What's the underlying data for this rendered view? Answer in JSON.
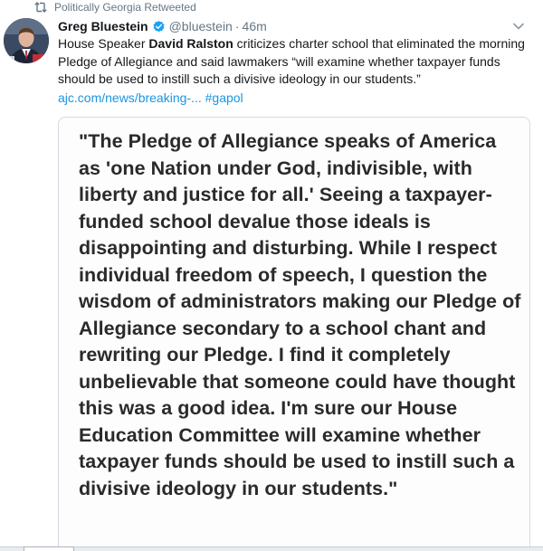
{
  "retweet": {
    "label": "Politically Georgia Retweeted",
    "icon": "retweet-icon"
  },
  "author": {
    "name": "Greg Bluestein",
    "handle": "@bluestein",
    "separator": "·",
    "time": "46m",
    "verified": true
  },
  "tweet": {
    "text_pre": "House Speaker ",
    "text_bold": "David Ralston",
    "text_post": " criticizes charter school that eliminated the morning Pledge of Allegiance and said lawmakers “will examine whether taxpayer funds should be used to instill such a divisive ideology in our students.”",
    "link": "ajc.com/news/breaking-...",
    "hashtag": "#gapol"
  },
  "image": {
    "quote": "\"The Pledge of Allegiance speaks of America as 'one Nation under God, indivisible, with liberty and justice for all.' Seeing a taxpayer-funded school devalue those ideals is disappointing and disturbing. While I respect individual freedom of speech, I question the wisdom of administrators making our Pledge of Allegiance secondary to a school chant and rewriting our Pledge. I find it completely unbelievable that someone could have thought this was a good idea. I'm sure our House Education Committee will examine whether taxpayer funds should be used to instill such a divisive ideology in our students.\""
  },
  "colors": {
    "link": "#1b95e0",
    "secondary": "#657786",
    "verified": "#1da1f2"
  }
}
